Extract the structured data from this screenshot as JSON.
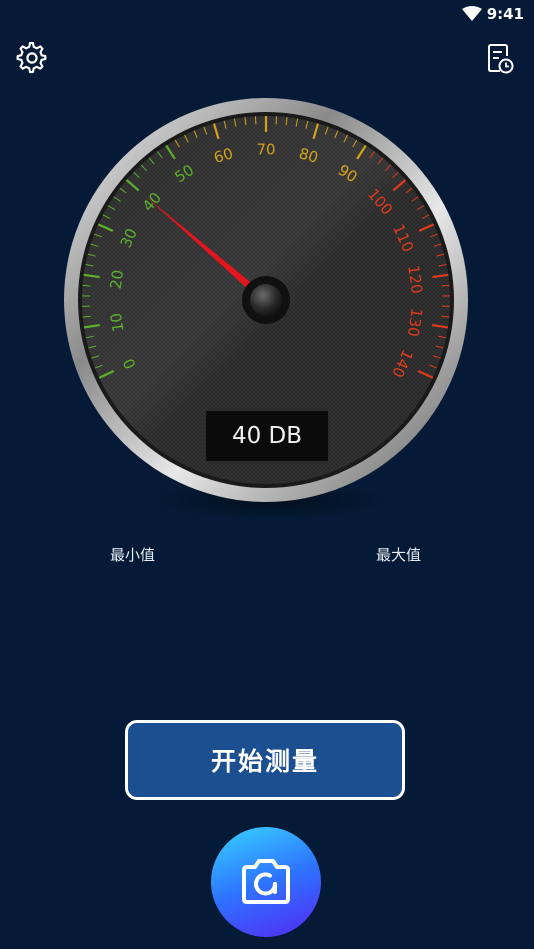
{
  "status_bar": {
    "time": "9:41"
  },
  "toolbar": {
    "settings_icon": "gear-icon",
    "record_icon": "history-document-icon"
  },
  "gauge": {
    "min": 0,
    "max": 140,
    "ticks": [
      "0",
      "10",
      "20",
      "30",
      "40",
      "50",
      "60",
      "70",
      "80",
      "90",
      "100",
      "110",
      "120",
      "130",
      "140"
    ],
    "value": 40,
    "readout": "40 DB",
    "tick_colors": {
      "low": "#5bb12c",
      "mid": "#d2a21a",
      "high": "#e13b1c"
    },
    "needle_color": "#e3141e"
  },
  "labels": {
    "min": "最小值",
    "max": "最大值"
  },
  "actions": {
    "start": "开始测量",
    "camera_icon": "camera-icon"
  }
}
